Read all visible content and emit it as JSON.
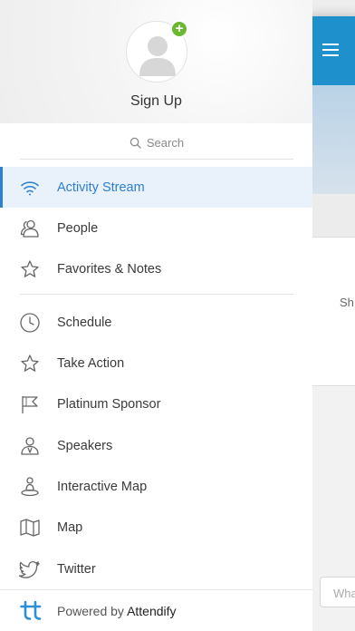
{
  "drawer": {
    "signup_label": "Sign Up",
    "add_badge": "+",
    "search_placeholder": "Search",
    "items": [
      {
        "label": "Activity Stream",
        "icon": "wifi-icon",
        "active": true
      },
      {
        "label": "People",
        "icon": "people-icon"
      },
      {
        "label": "Favorites & Notes",
        "icon": "star-icon"
      },
      {
        "label": "Schedule",
        "icon": "clock-icon"
      },
      {
        "label": "Take Action",
        "icon": "star-icon"
      },
      {
        "label": "Platinum Sponsor",
        "icon": "flag-icon"
      },
      {
        "label": "Speakers",
        "icon": "speaker-person-icon"
      },
      {
        "label": "Interactive Map",
        "icon": "location-person-icon"
      },
      {
        "label": "Map",
        "icon": "map-icon"
      },
      {
        "label": "Twitter",
        "icon": "twitter-bird-icon"
      }
    ],
    "footer": {
      "powered_by": "Powered by",
      "brand": "Attendify"
    }
  },
  "main": {
    "card_text": "Sh",
    "compose_placeholder": "Wha"
  },
  "colors": {
    "accent": "#2d7fd2",
    "topbar": "#1e90cc",
    "badge": "#6ab82f"
  }
}
